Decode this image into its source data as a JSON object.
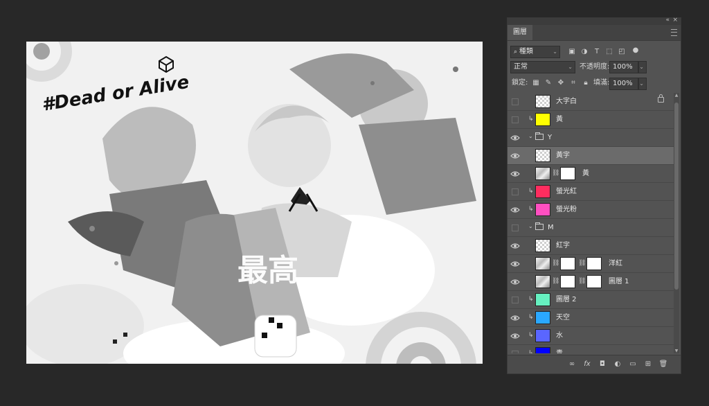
{
  "panel": {
    "tab_label": "圖層",
    "collapse_glyph": "«",
    "close_glyph": "×",
    "filter": {
      "selected": "種類"
    },
    "blend_mode": "正常",
    "opacity_label": "不透明度:",
    "opacity_value": "100%",
    "lock_label": "鎖定:",
    "fill_label": "填滿:",
    "fill_value": "100%"
  },
  "canvas": {
    "title_text": "#Dead or Alive",
    "big_glyph": "最高",
    "bottom_glyph": "最高"
  },
  "layers": [
    {
      "name": "大字白",
      "visible": false,
      "clip": false,
      "thumb": "checker",
      "locked": true
    },
    {
      "name": "黃",
      "visible": false,
      "clip": true,
      "thumb_color": "#ffff00"
    },
    {
      "name": "Y",
      "visible": true,
      "group": true
    },
    {
      "name": "黃字",
      "visible": true,
      "selected": true,
      "thumb": "checker"
    },
    {
      "name": "黃",
      "visible": true,
      "thumb": "art",
      "mask": true
    },
    {
      "name": "螢光紅",
      "visible": false,
      "clip": true,
      "thumb_color": "#ff2d5f"
    },
    {
      "name": "螢光粉",
      "visible": true,
      "clip": true,
      "thumb_color": "#ff4fc1"
    },
    {
      "name": "M",
      "visible": false,
      "group": true
    },
    {
      "name": "紅字",
      "visible": true,
      "thumb": "checker"
    },
    {
      "name": "洋紅",
      "visible": true,
      "thumb": "art",
      "mask": true,
      "mask2": true
    },
    {
      "name": "圖層 1",
      "visible": true,
      "thumb": "art",
      "mask": true,
      "mask2": true
    },
    {
      "name": "圖層 2",
      "visible": false,
      "clip": true,
      "thumb_color": "#66f0c0"
    },
    {
      "name": "天空",
      "visible": true,
      "clip": true,
      "thumb_color": "#2aa8ff"
    },
    {
      "name": "水",
      "visible": true,
      "clip": true,
      "thumb_color": "#5a66ff"
    },
    {
      "name": "青",
      "visible": false,
      "clip": true,
      "thumb_color": "#0000ff"
    }
  ],
  "bottom_icons": [
    "link-icon",
    "fx-icon",
    "mask-icon",
    "adjustment-icon",
    "group-icon",
    "new-layer-icon",
    "trash-icon"
  ],
  "fx_label": "fx"
}
